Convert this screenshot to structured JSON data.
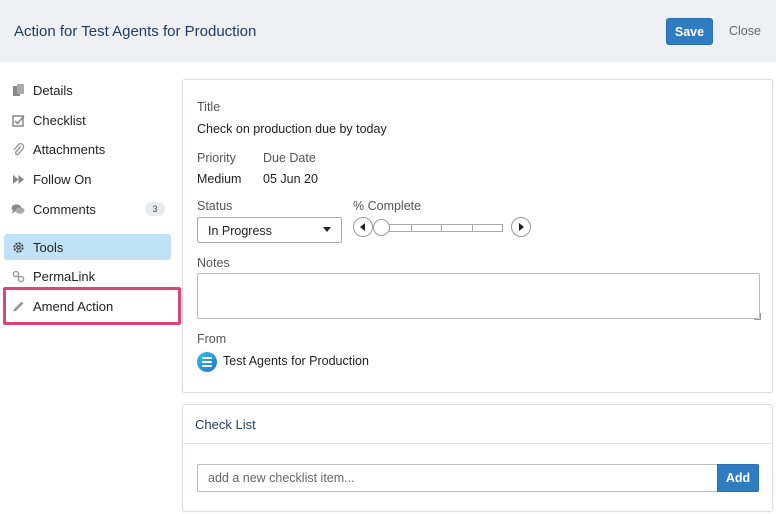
{
  "header": {
    "title": "Action for Test Agents for Production",
    "save_label": "Save",
    "close_label": "Close"
  },
  "sidebar": {
    "items": [
      {
        "label": "Details",
        "icon": "document-icon"
      },
      {
        "label": "Checklist",
        "icon": "checkbox-icon"
      },
      {
        "label": "Attachments",
        "icon": "paperclip-icon"
      },
      {
        "label": "Follow On",
        "icon": "fast-forward-icon"
      },
      {
        "label": "Comments",
        "icon": "chat-bubble-icon",
        "badge": "3"
      },
      {
        "label": "Tools",
        "icon": "gear-icon",
        "active": true
      },
      {
        "label": "PermaLink",
        "icon": "link-icon"
      },
      {
        "label": "Amend Action",
        "icon": "pencil-icon",
        "highlighted": true
      }
    ]
  },
  "details": {
    "title_label": "Title",
    "title_value": "Check on production due by today",
    "priority_label": "Priority",
    "priority_value": "Medium",
    "due_label": "Due Date",
    "due_value": "05 Jun 20",
    "status_label": "Status",
    "status_value": "In Progress",
    "complete_label": "% Complete",
    "complete_value": 0,
    "notes_label": "Notes",
    "notes_value": "",
    "from_label": "From",
    "from_value": "Test Agents for Production"
  },
  "checklist": {
    "title": "Check List",
    "placeholder": "add a new checklist item...",
    "add_label": "Add"
  },
  "colors": {
    "accent": "#2f7cc0",
    "active_nav": "#bfe2f6",
    "highlight": "#e0427a",
    "header_bg": "#eef0f3"
  }
}
